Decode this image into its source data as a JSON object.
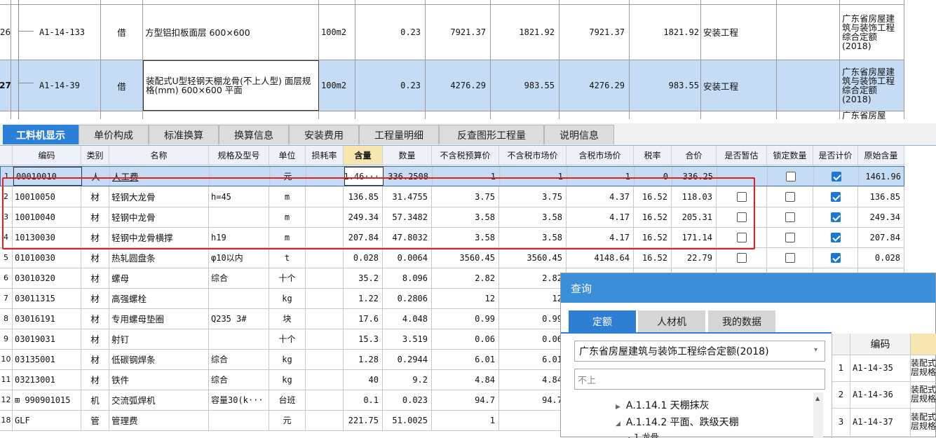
{
  "top_rows": [
    {
      "num": "26",
      "code": "A1-14-133",
      "type": "借",
      "name": "方型铝扣板面层 600×600",
      "unit": "100m2",
      "qty": "0.23",
      "price1": "7921.37",
      "total1": "1821.92",
      "price2": "7921.37",
      "total2": "1821.92",
      "major": "安装工程",
      "source": "广东省房屋建筑与装饰工程综合定额(2018)"
    },
    {
      "num": "27",
      "code": "A1-14-39",
      "type": "借",
      "name": "装配式U型轻钢天棚龙骨(不上人型) 面层规格(mm) 600×600 平面",
      "unit": "100m2",
      "qty": "0.23",
      "price1": "4276.29",
      "total1": "983.55",
      "price2": "4276.29",
      "total2": "983.55",
      "major": "安装工程",
      "source": "广东省房屋建筑与装饰工程综合定额(2018)"
    }
  ],
  "top_partial_text": "广东省房屋",
  "tabs": [
    "工料机显示",
    "单价构成",
    "标准换算",
    "换算信息",
    "安装费用",
    "工程量明细",
    "反查图形工程量",
    "说明信息"
  ],
  "grid_headers": [
    "编码",
    "类别",
    "名称",
    "规格及型号",
    "单位",
    "损耗率",
    "含量",
    "数量",
    "不含税预算价",
    "不含税市场价",
    "含税市场价",
    "税率",
    "合价",
    "是否暂估",
    "锁定数量",
    "是否计价",
    "原始含量"
  ],
  "grid_rows": [
    {
      "n": "1",
      "code": "00010010",
      "cat": "人",
      "name": "人工费",
      "spec": "",
      "unit": "元",
      "loss": "",
      "content": "1.46···",
      "amount": "336.2508",
      "p1": "1",
      "p2": "1",
      "p3": "1",
      "tax": "0",
      "total": "336.25",
      "est": "",
      "lock": false,
      "priced": true,
      "orig": "1461.96"
    },
    {
      "n": "2",
      "code": "10010050",
      "cat": "材",
      "name": "轻钢大龙骨",
      "spec": "h=45",
      "unit": "m",
      "loss": "",
      "content": "136.85",
      "amount": "31.4755",
      "p1": "3.75",
      "p2": "3.75",
      "p3": "4.37",
      "tax": "16.52",
      "total": "118.03",
      "est": false,
      "lock": false,
      "priced": true,
      "orig": "136.85"
    },
    {
      "n": "3",
      "code": "10010040",
      "cat": "材",
      "name": "轻钢中龙骨",
      "spec": "",
      "unit": "m",
      "loss": "",
      "content": "249.34",
      "amount": "57.3482",
      "p1": "3.58",
      "p2": "3.58",
      "p3": "4.17",
      "tax": "16.52",
      "total": "205.31",
      "est": false,
      "lock": false,
      "priced": true,
      "orig": "249.34"
    },
    {
      "n": "4",
      "code": "10130030",
      "cat": "材",
      "name": "轻钢中龙骨横撑",
      "spec": "h19",
      "unit": "m",
      "loss": "",
      "content": "207.84",
      "amount": "47.8032",
      "p1": "3.58",
      "p2": "3.58",
      "p3": "4.17",
      "tax": "16.52",
      "total": "171.14",
      "est": false,
      "lock": false,
      "priced": true,
      "orig": "207.84"
    },
    {
      "n": "5",
      "code": "01010030",
      "cat": "材",
      "name": "热轧圆盘条",
      "spec": "φ10以内",
      "unit": "t",
      "loss": "",
      "content": "0.028",
      "amount": "0.0064",
      "p1": "3560.45",
      "p2": "3560.45",
      "p3": "4148.64",
      "tax": "16.52",
      "total": "22.79",
      "est": false,
      "lock": false,
      "priced": true,
      "orig": "0.028"
    },
    {
      "n": "6",
      "code": "03010320",
      "cat": "材",
      "name": "螺母",
      "spec": "综合",
      "unit": "十个",
      "loss": "",
      "content": "35.2",
      "amount": "8.096",
      "p1": "2.82",
      "p2": "2.82",
      "p3": "",
      "tax": "",
      "total": "",
      "est": "",
      "lock": "",
      "priced": "",
      "orig": ""
    },
    {
      "n": "7",
      "code": "03011315",
      "cat": "材",
      "name": "高强螺栓",
      "spec": "",
      "unit": "kg",
      "loss": "",
      "content": "1.22",
      "amount": "0.2806",
      "p1": "12",
      "p2": "12",
      "p3": "",
      "tax": "",
      "total": "",
      "est": "",
      "lock": "",
      "priced": "",
      "orig": ""
    },
    {
      "n": "8",
      "code": "03016191",
      "cat": "材",
      "name": "专用螺母垫圈",
      "spec": "Q235 3#",
      "unit": "块",
      "loss": "",
      "content": "17.6",
      "amount": "4.048",
      "p1": "0.99",
      "p2": "0.99",
      "p3": "",
      "tax": "",
      "total": "",
      "est": "",
      "lock": "",
      "priced": "",
      "orig": ""
    },
    {
      "n": "9",
      "code": "03019031",
      "cat": "材",
      "name": "射钉",
      "spec": "",
      "unit": "十个",
      "loss": "",
      "content": "15.3",
      "amount": "3.519",
      "p1": "0.06",
      "p2": "0.06",
      "p3": "",
      "tax": "",
      "total": "",
      "est": "",
      "lock": "",
      "priced": "",
      "orig": ""
    },
    {
      "n": "10",
      "code": "03135001",
      "cat": "材",
      "name": "低碳钢焊条",
      "spec": "综合",
      "unit": "kg",
      "loss": "",
      "content": "1.28",
      "amount": "0.2944",
      "p1": "6.01",
      "p2": "6.01",
      "p3": "",
      "tax": "",
      "total": "",
      "est": "",
      "lock": "",
      "priced": "",
      "orig": ""
    },
    {
      "n": "11",
      "code": "03213001",
      "cat": "材",
      "name": "铁件",
      "spec": "综合",
      "unit": "kg",
      "loss": "",
      "content": "40",
      "amount": "9.2",
      "p1": "4.84",
      "p2": "4.84",
      "p3": "",
      "tax": "",
      "total": "",
      "est": "",
      "lock": "",
      "priced": "",
      "orig": ""
    },
    {
      "n": "12",
      "code": "⊞ 990901015",
      "cat": "机",
      "name": "交流弧焊机",
      "spec": "容量30(k···",
      "unit": "台班",
      "loss": "",
      "content": "0.1",
      "amount": "0.023",
      "p1": "94.7",
      "p2": "94.7",
      "p3": "",
      "tax": "",
      "total": "",
      "est": "",
      "lock": "",
      "priced": "",
      "orig": ""
    },
    {
      "n": "18",
      "code": "GLF",
      "cat": "管",
      "name": "管理费",
      "spec": "",
      "unit": "元",
      "loss": "",
      "content": "221.75",
      "amount": "51.0025",
      "p1": "1",
      "p2": "",
      "p3": "",
      "tax": "",
      "total": "",
      "est": "",
      "lock": "",
      "priced": "",
      "orig": ""
    }
  ],
  "query": {
    "title": "查询",
    "tabs": [
      "定额",
      "人材机",
      "我的数据"
    ],
    "library": "广东省房屋建筑与装饰工程综合定额(2018)",
    "search_value": "不上",
    "tree": [
      "A.1.14.1 天棚抹灰",
      "A.1.14.2 平面、跌级天棚",
      "1 龙骨"
    ],
    "results_header": "编码",
    "results": [
      {
        "n": "1",
        "code": "A1-14-35",
        "name": "装配式层规格"
      },
      {
        "n": "2",
        "code": "A1-14-36",
        "name": "装配式层规格"
      },
      {
        "n": "3",
        "code": "A1-14-37",
        "name": "装配式层规格"
      }
    ]
  },
  "colors": {
    "accent": "#2b7fd6",
    "selected_row": "#c6dcf5",
    "highlight_header": "#f8e6b0",
    "red_frame": "#e02020",
    "checkbox_on": "#1a78d4"
  }
}
